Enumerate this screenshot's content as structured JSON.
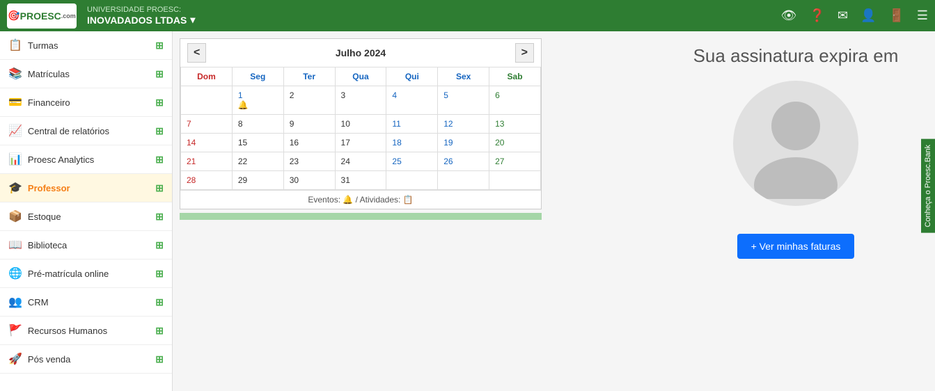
{
  "topbar": {
    "university_label": "UNIVERSIDADE PROESC:",
    "institution_name": "INOVADADOS LTDAS",
    "dropdown_icon": "▾",
    "logo_text": "PROESC",
    "logo_sub": ".com"
  },
  "sidebar": {
    "items": [
      {
        "id": "turmas",
        "label": "Turmas",
        "icon": "📋",
        "active": false
      },
      {
        "id": "matriculas",
        "label": "Matrículas",
        "icon": "📚",
        "active": false
      },
      {
        "id": "financeiro",
        "label": "Financeiro",
        "icon": "💳",
        "active": false
      },
      {
        "id": "relatorios",
        "label": "Central de relatórios",
        "icon": "📈",
        "active": false
      },
      {
        "id": "analytics",
        "label": "Proesc Analytics",
        "icon": "📊",
        "active": false
      },
      {
        "id": "professor",
        "label": "Professor",
        "icon": "🎓",
        "active": true
      },
      {
        "id": "estoque",
        "label": "Estoque",
        "icon": "📦",
        "active": false
      },
      {
        "id": "biblioteca",
        "label": "Biblioteca",
        "icon": "📖",
        "active": false
      },
      {
        "id": "pre-matricula",
        "label": "Pré-matrícula online",
        "icon": "🌐",
        "active": false
      },
      {
        "id": "crm",
        "label": "CRM",
        "icon": "👥",
        "active": false
      },
      {
        "id": "rh",
        "label": "Recursos Humanos",
        "icon": "🚩",
        "active": false
      },
      {
        "id": "pos-venda",
        "label": "Pós venda",
        "icon": "🚀",
        "active": false
      }
    ]
  },
  "calendar": {
    "title": "Julho 2024",
    "prev_label": "<",
    "next_label": ">",
    "days_of_week": [
      "Dom",
      "Seg",
      "Ter",
      "Qua",
      "Qui",
      "Sex",
      "Sab"
    ],
    "weeks": [
      [
        {
          "day": "",
          "cls": "dom"
        },
        {
          "day": "1",
          "cls": "event-day",
          "bell": true
        },
        {
          "day": "2",
          "cls": ""
        },
        {
          "day": "3",
          "cls": ""
        },
        {
          "day": "4",
          "cls": "qui"
        },
        {
          "day": "5",
          "cls": "sex"
        },
        {
          "day": "6",
          "cls": "sab"
        }
      ],
      [
        {
          "day": "7",
          "cls": "dom"
        },
        {
          "day": "8",
          "cls": ""
        },
        {
          "day": "9",
          "cls": ""
        },
        {
          "day": "10",
          "cls": ""
        },
        {
          "day": "11",
          "cls": "qui"
        },
        {
          "day": "12",
          "cls": "sex"
        },
        {
          "day": "13",
          "cls": "sab"
        }
      ],
      [
        {
          "day": "14",
          "cls": "dom"
        },
        {
          "day": "15",
          "cls": ""
        },
        {
          "day": "16",
          "cls": ""
        },
        {
          "day": "17",
          "cls": ""
        },
        {
          "day": "18",
          "cls": "qui"
        },
        {
          "day": "19",
          "cls": "sex"
        },
        {
          "day": "20",
          "cls": "sab"
        }
      ],
      [
        {
          "day": "21",
          "cls": "dom"
        },
        {
          "day": "22",
          "cls": ""
        },
        {
          "day": "23",
          "cls": ""
        },
        {
          "day": "24",
          "cls": ""
        },
        {
          "day": "25",
          "cls": "qui"
        },
        {
          "day": "26",
          "cls": "sex"
        },
        {
          "day": "27",
          "cls": "sab"
        }
      ],
      [
        {
          "day": "28",
          "cls": "dom"
        },
        {
          "day": "29",
          "cls": ""
        },
        {
          "day": "30",
          "cls": ""
        },
        {
          "day": "31",
          "cls": ""
        },
        {
          "day": "",
          "cls": ""
        },
        {
          "day": "",
          "cls": ""
        },
        {
          "day": "",
          "cls": ""
        }
      ]
    ],
    "footer_eventos": "Eventos:",
    "footer_atividades": "/ Atividades:"
  },
  "main_right": {
    "subscription_title": "Sua assinatura expira em",
    "btn_faturas_label": "+ Ver minhas faturas"
  },
  "side_promo": {
    "label": "Conheça o Proesc.Bank"
  }
}
